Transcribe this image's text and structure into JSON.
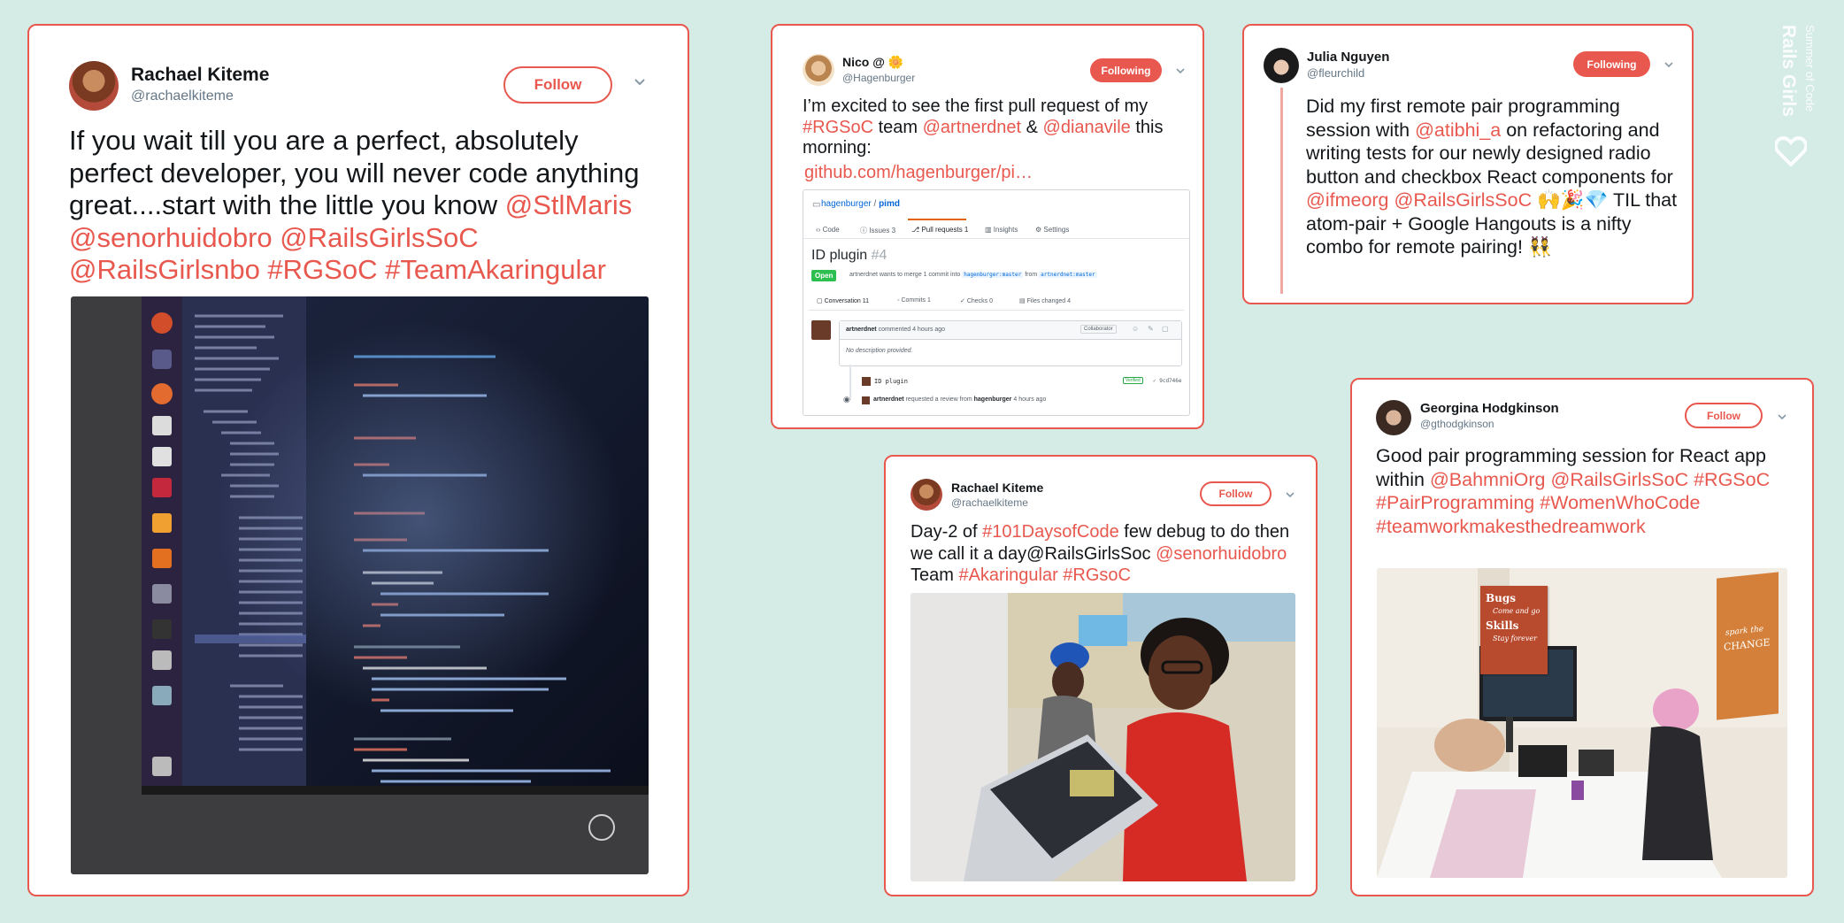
{
  "tweets": [
    {
      "name": "Rachael Kiteme",
      "handle": "@rachaelkiteme",
      "button": "Follow",
      "segments": [
        {
          "text": "If you wait till you are a perfect, absolutely perfect developer, you will never code anything great....start with the little you know ",
          "link": false
        },
        {
          "text": "@StlMaris @senorhuidobro @RailsGirlsSoC @RailsGirlsnbo #RGSoC #TeamAkaringular",
          "link": true
        }
      ],
      "media_alt": "laptop screen with code editor"
    },
    {
      "name": "Nico @ 🌼",
      "handle": "@Hagenburger",
      "button": "Following",
      "segments": [
        {
          "text": "I’m excited to see the first pull request of my ",
          "link": false
        },
        {
          "text": "#RGSoC",
          "link": true
        },
        {
          "text": " team ",
          "link": false
        },
        {
          "text": "@artnerdnet",
          "link": true
        },
        {
          "text": " & ",
          "link": false
        },
        {
          "text": "@dianavile",
          "link": true
        },
        {
          "text": " this morning: ",
          "link": false
        }
      ],
      "url": "github.com/hagenburger/pi…",
      "github": {
        "repo_owner": "hagenburger",
        "repo_sep": " / ",
        "repo_name": "pimd",
        "tabs": [
          "Code",
          "Issues 3",
          "Pull requests 1",
          "Insights",
          "Settings"
        ],
        "pr_title": "ID plugin",
        "pr_number": "#4",
        "state": "Open",
        "pr_meta": "artnerdnet wants to merge 1 commit into",
        "base_branch": "hagenburger:master",
        "from_word": "from",
        "head_branch": "artnerdnet:master",
        "subtabs": [
          "Conversation 11",
          "Commits 1",
          "Checks 0",
          "Files changed 4"
        ],
        "comment_author": "artnerdnet",
        "comment_time": "commented 4 hours ago",
        "comment_role": "Collaborator",
        "comment_body": "No description provided.",
        "commit_msg": "ID plugin",
        "commit_verified": "Verified",
        "commit_sha": "9cd746e",
        "review_user": "artnerdnet",
        "review_text": "requested a review from",
        "review_target": "hagenburger",
        "review_time": "4 hours ago"
      }
    },
    {
      "name": "Julia Nguyen",
      "handle": "@fleurchild",
      "button": "Following",
      "segments": [
        {
          "text": "Did my first remote pair programming session with ",
          "link": false
        },
        {
          "text": "@atibhi_a",
          "link": true
        },
        {
          "text": " on refactoring and writing tests for our newly designed radio button and checkbox React components for ",
          "link": false
        },
        {
          "text": "@ifmeorg @RailsGirlsSoC",
          "link": true
        },
        {
          "text": " 🙌🎉💎 TIL that atom-pair + Google Hangouts is a nifty combo for remote pairing! 👯",
          "link": false
        }
      ]
    },
    {
      "name": "Rachael Kiteme",
      "handle": "@rachaelkiteme",
      "button": "Follow",
      "segments": [
        {
          "text": "Day-2 of ",
          "link": false
        },
        {
          "text": "#101DaysofCode",
          "link": true
        },
        {
          "text": " few debug to do then we call it a day@RailsGirlsSoc ",
          "link": false
        },
        {
          "text": "@senorhuidobro",
          "link": true
        },
        {
          "text": "  Team ",
          "link": false
        },
        {
          "text": "#Akaringular #RGsoC",
          "link": true
        }
      ],
      "media_alt": "two women smiling at laptop"
    },
    {
      "name": "Georgina Hodgkinson",
      "handle": "@gthodgkinson",
      "button": "Follow",
      "segments": [
        {
          "text": "Good pair programming session for React app within ",
          "link": false
        },
        {
          "text": "@BahmniOrg @RailsGirlsSoC #RGSoC #PairProgramming #WomenWhoCode #teamworkmakesthedreamwork",
          "link": true
        }
      ],
      "media_alt": "pair programming room with posters",
      "poster_left": [
        "Bugs",
        "Come and go",
        "Skills",
        "Stay forever"
      ],
      "poster_right": [
        "spark the",
        "CHANGE"
      ]
    }
  ],
  "watermark": {
    "line1": "Rails Girls",
    "line2": "Summer of Code"
  },
  "colors": {
    "accent": "#e8584e",
    "background": "#d5ebe6",
    "handle": "#657786"
  }
}
